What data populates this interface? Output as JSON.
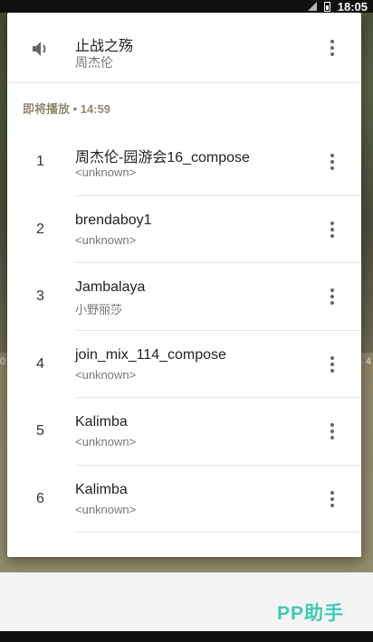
{
  "status_bar": {
    "time": "18:05",
    "icons": [
      "signal-icon",
      "battery-charging-icon"
    ]
  },
  "background": {
    "left_label": "0",
    "right_label": "4"
  },
  "now_playing": {
    "icon": "speaker-icon",
    "title": "止战之殇",
    "artist": "周杰伦"
  },
  "section": {
    "label": "即将播放 • 14:59"
  },
  "queue": [
    {
      "index": "1",
      "title": "周杰伦-园游会16_compose",
      "subtitle": "<unknown>"
    },
    {
      "index": "2",
      "title": "brendaboy1",
      "subtitle": "<unknown>"
    },
    {
      "index": "3",
      "title": "Jambalaya",
      "subtitle": "小野丽莎"
    },
    {
      "index": "4",
      "title": "join_mix_114_compose",
      "subtitle": "<unknown>"
    },
    {
      "index": "5",
      "title": "Kalimba",
      "subtitle": "<unknown>"
    },
    {
      "index": "6",
      "title": "Kalimba",
      "subtitle": "<unknown>"
    }
  ],
  "brand": {
    "text": "PP助手",
    "color": "#3ec9b9"
  }
}
